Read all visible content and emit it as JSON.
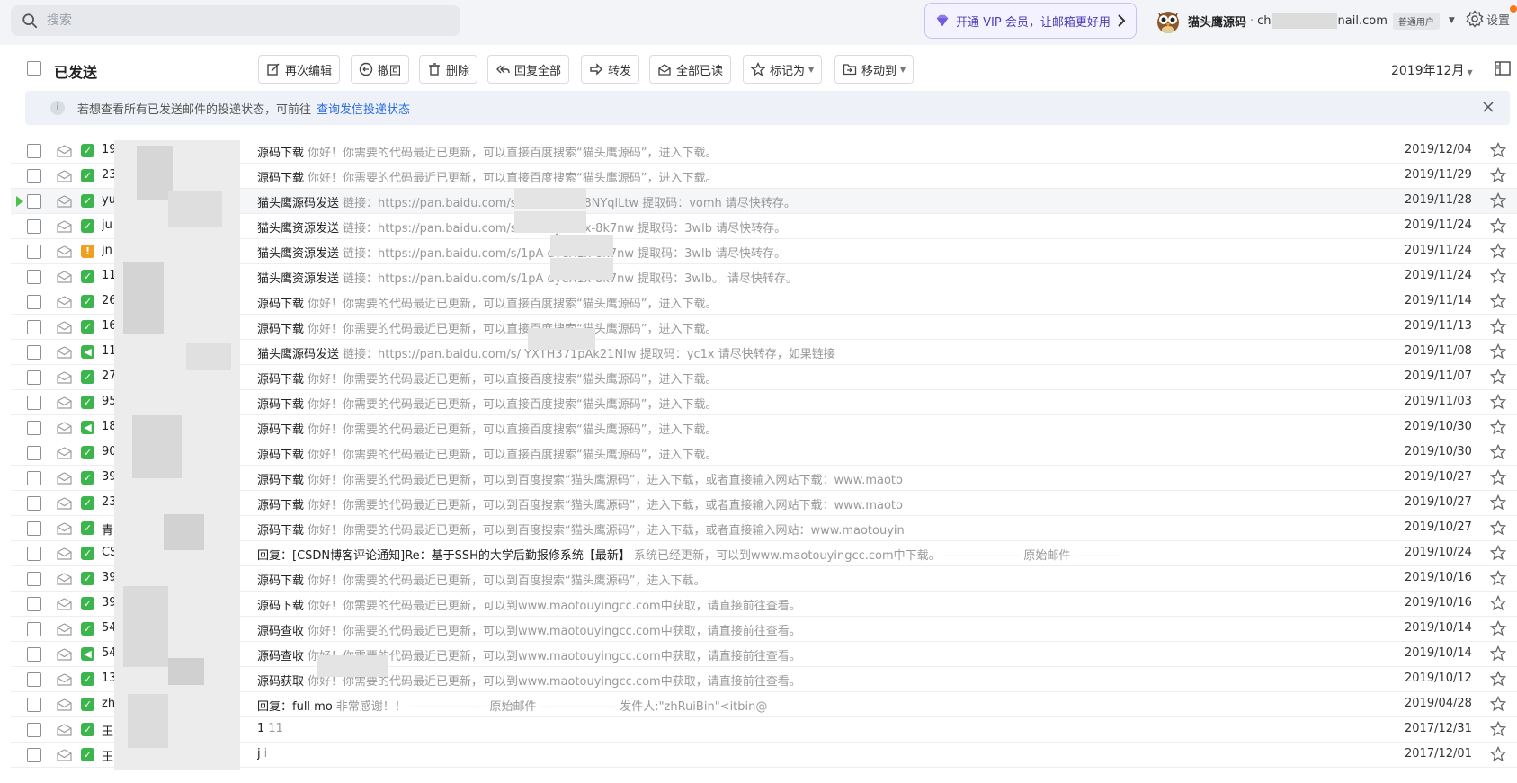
{
  "search": {
    "placeholder": "搜索"
  },
  "vip": {
    "label": "开通 VIP 会员，让邮箱更好用",
    "accent": "#4b3fb6"
  },
  "account": {
    "name": "猫头鹰源码",
    "sep": "·",
    "mail_prefix": "ch",
    "mail_suffix": "nail.com",
    "badge": "普通用户"
  },
  "settings": {
    "label": "设置"
  },
  "folder": {
    "title": "已发送"
  },
  "toolbar": {
    "reedit": "再次编辑",
    "recall": "撤回",
    "delete": "删除",
    "reply_all": "回复全部",
    "forward": "转发",
    "mark_all_read": "全部已读",
    "mark_as": "标记为",
    "move_to": "移动到",
    "month": "2019年12月"
  },
  "notice": {
    "text": "若想查看所有已发送邮件的投递状态，可前往",
    "link": "查询发信投递状态"
  },
  "mails": [
    {
      "sender": "19",
      "status": "ok",
      "subject": "源码下载",
      "preview": "你好！你需要的代码最近已更新，可以直接百度搜索“猫头鹰源码”，进入下载。",
      "date": "2019/12/04"
    },
    {
      "sender": "23",
      "status": "ok",
      "subject": "源码下载",
      "preview": "你好！你需要的代码最近已更新，可以直接百度搜索“猫头鹰源码”，进入下载。",
      "date": "2019/11/29"
    },
    {
      "sender": "yu",
      "status": "ok",
      "subject": "猫头鹰源码发送",
      "preview": "链接：https://pan.baidu.com/s        v6mD2Tbk8NYqlLtw 提取码：vomh 请尽快转存。",
      "date": "2019/11/28",
      "highlight": true
    },
    {
      "sender": "ju",
      "status": "ok",
      "subject": "猫头鹰资源发送",
      "preview": "链接：https://pan.baidu.com/s        GFPfdyeX1x-8k7nw 提取码：3wlb 请尽快转存。",
      "date": "2019/11/24"
    },
    {
      "sender": "jn",
      "status": "warn",
      "subject": "猫头鹰资源发送",
      "preview": "链接：https://pan.baidu.com/s/1pA        dyeX1x-8k7nw 提取码：3wlb 请尽快转存。",
      "date": "2019/11/24"
    },
    {
      "sender": "11",
      "status": "ok",
      "subject": "猫头鹰资源发送",
      "preview": "链接：https://pan.baidu.com/s/1pA        dyeX1x-8k7nw 提取码：3wlb。 请尽快转存。",
      "date": "2019/11/24"
    },
    {
      "sender": "26",
      "status": "ok",
      "subject": "源码下载",
      "preview": "你好！你需要的代码最近已更新，可以直接百度搜索“猫头鹰源码”，进入下载。",
      "date": "2019/11/14"
    },
    {
      "sender": "16",
      "status": "ok",
      "subject": "源码下载",
      "preview": "你好！你需要的代码最近已更新，可以直接百度搜索“猫头鹰源码”，进入下载。",
      "date": "2019/11/13"
    },
    {
      "sender": "11",
      "status": "part",
      "subject": "猫头鹰源码发送",
      "preview": "链接：https://pan.baidu.com/s/        YXTH371pAk21NIw 提取码：yc1x 请尽快转存，如果链接",
      "date": "2019/11/08"
    },
    {
      "sender": "27",
      "status": "ok",
      "subject": "源码下载",
      "preview": "你好！你需要的代码最近已更新，可以直接百度搜索“猫头鹰源码”，进入下载。",
      "date": "2019/11/07"
    },
    {
      "sender": "95",
      "status": "ok",
      "subject": "源码下载",
      "preview": "你好！你需要的代码最近已更新，可以直接百度搜索“猫头鹰源码”，进入下载。",
      "date": "2019/11/03"
    },
    {
      "sender": "18",
      "status": "part",
      "subject": "源码下载",
      "preview": "你好！你需要的代码最近已更新，可以直接百度搜索“猫头鹰源码”，进入下载。",
      "date": "2019/10/30"
    },
    {
      "sender": "90",
      "status": "ok",
      "subject": "源码下载",
      "preview": "你好！你需要的代码最近已更新，可以直接百度搜索“猫头鹰源码”，进入下载。",
      "date": "2019/10/30"
    },
    {
      "sender": "39",
      "status": "ok",
      "subject": "源码下载",
      "preview": "你好！你需要的代码最近已更新，可以到百度搜索“猫头鹰源码”，进入下载，或者直接输入网站下载：www.maoto",
      "date": "2019/10/27"
    },
    {
      "sender": "23",
      "status": "ok",
      "subject": "源码下载",
      "preview": "你好！你需要的代码最近已更新，可以到百度搜索“猫头鹰源码”，进入下载，或者直接输入网站下载：www.maoto",
      "date": "2019/10/27"
    },
    {
      "sender": "青",
      "status": "ok",
      "subject": "源码下载",
      "preview": "你好！你需要的代码最近已更新，可以到百度搜索“猫头鹰源码”，进入下载，或者直接输入网站：www.maotouyin",
      "date": "2019/10/27"
    },
    {
      "sender": "CS",
      "status": "ok",
      "subject": "回复：[CSDN博客评论通知]Re：基于SSH的大学后勤报修系统【最新】",
      "preview": "系统已经更新，可以到www.maotouyingcc.com中下载。 ------------------ 原始邮件 -----------",
      "date": "2019/10/24"
    },
    {
      "sender": "39",
      "status": "ok",
      "subject": "源码下载",
      "preview": "你好！你需要的代码最近已更新，可以到百度搜索“猫头鹰源码”，进入下载。",
      "date": "2019/10/16"
    },
    {
      "sender": "39",
      "status": "ok",
      "subject": "源码下载",
      "preview": "你好！你需要的代码最近已更新，可以到www.maotouyingcc.com中获取，请直接前往查看。",
      "date": "2019/10/16"
    },
    {
      "sender": "54",
      "status": "ok",
      "subject": "源码查收",
      "preview": "你好！你需要的代码最近已更新，可以到www.maotouyingcc.com中获取，请直接前往查看。",
      "date": "2019/10/14"
    },
    {
      "sender": "54",
      "status": "part",
      "subject": "源码查收",
      "preview": "你好！你需要的代码最近已更新，可以到www.maotouyingcc.com中获取，请直接前往查看。",
      "date": "2019/10/14"
    },
    {
      "sender": "13",
      "status": "ok",
      "subject": "源码获取",
      "preview": "你好！你需要的代码最近已更新，可以到www.maotouyingcc.com中获取，请直接前往查看。",
      "date": "2019/10/12"
    },
    {
      "sender": "zh",
      "status": "ok",
      "subject": "回复：full          mo",
      "preview": "非常感谢！！ ------------------ 原始邮件 ------------------ 发件人:\"zhRuiBin\"<itbin@",
      "date": "2019/04/28"
    },
    {
      "sender": "王",
      "status": "ok",
      "subject": "1",
      "preview": "11",
      "date": "2017/12/31"
    },
    {
      "sender": "王",
      "status": "ok",
      "subject": "j",
      "preview": "i",
      "date": "2017/12/01"
    }
  ]
}
